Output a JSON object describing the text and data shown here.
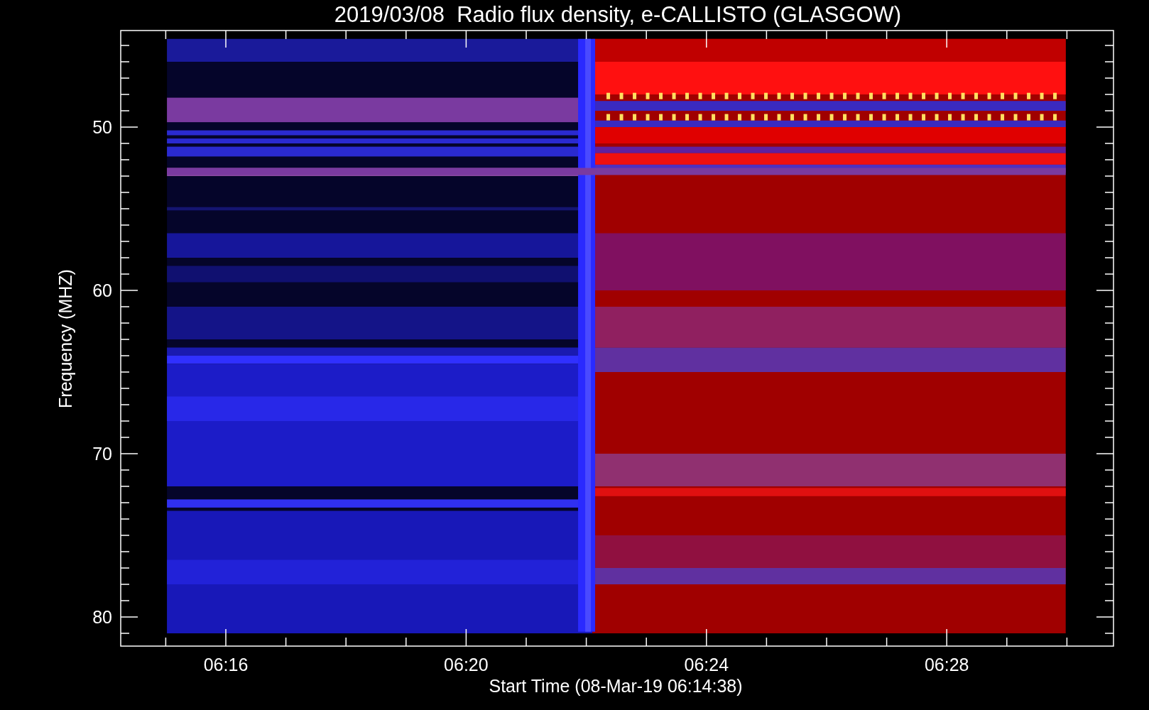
{
  "title": "2019/03/08  Radio flux density, e-CALLISTO (GLASGOW)",
  "y_axis": {
    "label": "Frequency (MHZ)",
    "ticks": [
      "50",
      "60",
      "70",
      "80"
    ]
  },
  "x_axis": {
    "label": "Start Time (08-Mar-19 06:14:38)",
    "ticks": [
      "06:16",
      "06:20",
      "06:24",
      "06:28"
    ]
  }
}
